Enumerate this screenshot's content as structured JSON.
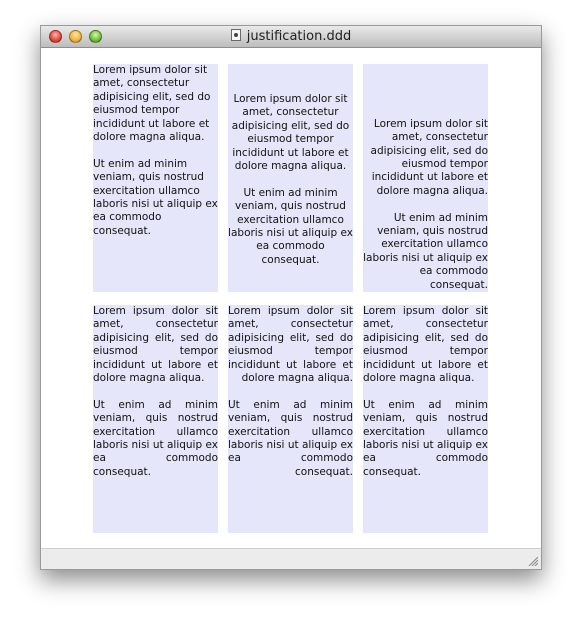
{
  "window": {
    "title": "justification.ddd",
    "cell_color": "#e6e6fb"
  },
  "paragraphs": [
    "Lorem ipsum dolor sit amet, consectetur adipisicing elit, sed do eiusmod tempor incididunt ut labore et dolore magna aliqua.",
    "Ut enim ad minim veniam, quis nostrud exercitation ullamco laboris nisi ut aliquip ex ea commodo consequat."
  ]
}
